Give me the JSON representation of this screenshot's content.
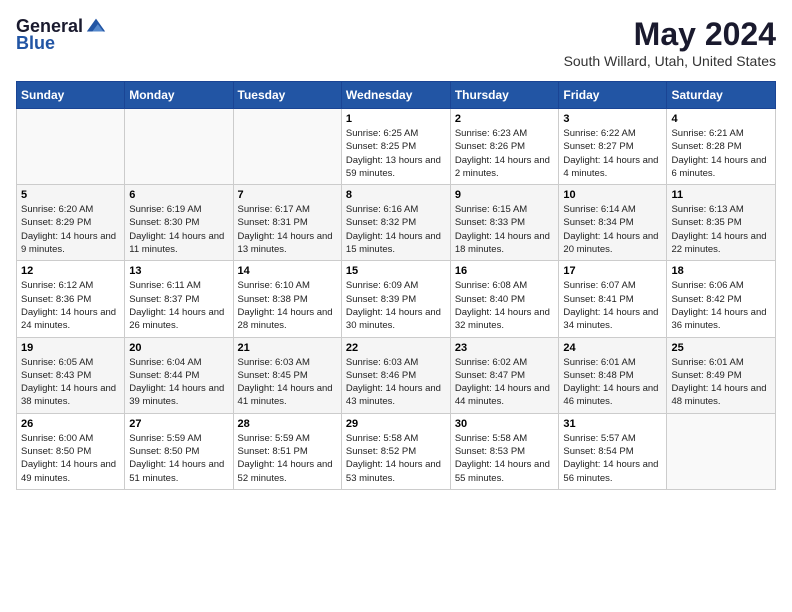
{
  "header": {
    "logo_general": "General",
    "logo_blue": "Blue",
    "month": "May 2024",
    "location": "South Willard, Utah, United States"
  },
  "weekdays": [
    "Sunday",
    "Monday",
    "Tuesday",
    "Wednesday",
    "Thursday",
    "Friday",
    "Saturday"
  ],
  "weeks": [
    [
      {
        "day": "",
        "info": ""
      },
      {
        "day": "",
        "info": ""
      },
      {
        "day": "",
        "info": ""
      },
      {
        "day": "1",
        "info": "Sunrise: 6:25 AM\nSunset: 8:25 PM\nDaylight: 13 hours and 59 minutes."
      },
      {
        "day": "2",
        "info": "Sunrise: 6:23 AM\nSunset: 8:26 PM\nDaylight: 14 hours and 2 minutes."
      },
      {
        "day": "3",
        "info": "Sunrise: 6:22 AM\nSunset: 8:27 PM\nDaylight: 14 hours and 4 minutes."
      },
      {
        "day": "4",
        "info": "Sunrise: 6:21 AM\nSunset: 8:28 PM\nDaylight: 14 hours and 6 minutes."
      }
    ],
    [
      {
        "day": "5",
        "info": "Sunrise: 6:20 AM\nSunset: 8:29 PM\nDaylight: 14 hours and 9 minutes."
      },
      {
        "day": "6",
        "info": "Sunrise: 6:19 AM\nSunset: 8:30 PM\nDaylight: 14 hours and 11 minutes."
      },
      {
        "day": "7",
        "info": "Sunrise: 6:17 AM\nSunset: 8:31 PM\nDaylight: 14 hours and 13 minutes."
      },
      {
        "day": "8",
        "info": "Sunrise: 6:16 AM\nSunset: 8:32 PM\nDaylight: 14 hours and 15 minutes."
      },
      {
        "day": "9",
        "info": "Sunrise: 6:15 AM\nSunset: 8:33 PM\nDaylight: 14 hours and 18 minutes."
      },
      {
        "day": "10",
        "info": "Sunrise: 6:14 AM\nSunset: 8:34 PM\nDaylight: 14 hours and 20 minutes."
      },
      {
        "day": "11",
        "info": "Sunrise: 6:13 AM\nSunset: 8:35 PM\nDaylight: 14 hours and 22 minutes."
      }
    ],
    [
      {
        "day": "12",
        "info": "Sunrise: 6:12 AM\nSunset: 8:36 PM\nDaylight: 14 hours and 24 minutes."
      },
      {
        "day": "13",
        "info": "Sunrise: 6:11 AM\nSunset: 8:37 PM\nDaylight: 14 hours and 26 minutes."
      },
      {
        "day": "14",
        "info": "Sunrise: 6:10 AM\nSunset: 8:38 PM\nDaylight: 14 hours and 28 minutes."
      },
      {
        "day": "15",
        "info": "Sunrise: 6:09 AM\nSunset: 8:39 PM\nDaylight: 14 hours and 30 minutes."
      },
      {
        "day": "16",
        "info": "Sunrise: 6:08 AM\nSunset: 8:40 PM\nDaylight: 14 hours and 32 minutes."
      },
      {
        "day": "17",
        "info": "Sunrise: 6:07 AM\nSunset: 8:41 PM\nDaylight: 14 hours and 34 minutes."
      },
      {
        "day": "18",
        "info": "Sunrise: 6:06 AM\nSunset: 8:42 PM\nDaylight: 14 hours and 36 minutes."
      }
    ],
    [
      {
        "day": "19",
        "info": "Sunrise: 6:05 AM\nSunset: 8:43 PM\nDaylight: 14 hours and 38 minutes."
      },
      {
        "day": "20",
        "info": "Sunrise: 6:04 AM\nSunset: 8:44 PM\nDaylight: 14 hours and 39 minutes."
      },
      {
        "day": "21",
        "info": "Sunrise: 6:03 AM\nSunset: 8:45 PM\nDaylight: 14 hours and 41 minutes."
      },
      {
        "day": "22",
        "info": "Sunrise: 6:03 AM\nSunset: 8:46 PM\nDaylight: 14 hours and 43 minutes."
      },
      {
        "day": "23",
        "info": "Sunrise: 6:02 AM\nSunset: 8:47 PM\nDaylight: 14 hours and 44 minutes."
      },
      {
        "day": "24",
        "info": "Sunrise: 6:01 AM\nSunset: 8:48 PM\nDaylight: 14 hours and 46 minutes."
      },
      {
        "day": "25",
        "info": "Sunrise: 6:01 AM\nSunset: 8:49 PM\nDaylight: 14 hours and 48 minutes."
      }
    ],
    [
      {
        "day": "26",
        "info": "Sunrise: 6:00 AM\nSunset: 8:50 PM\nDaylight: 14 hours and 49 minutes."
      },
      {
        "day": "27",
        "info": "Sunrise: 5:59 AM\nSunset: 8:50 PM\nDaylight: 14 hours and 51 minutes."
      },
      {
        "day": "28",
        "info": "Sunrise: 5:59 AM\nSunset: 8:51 PM\nDaylight: 14 hours and 52 minutes."
      },
      {
        "day": "29",
        "info": "Sunrise: 5:58 AM\nSunset: 8:52 PM\nDaylight: 14 hours and 53 minutes."
      },
      {
        "day": "30",
        "info": "Sunrise: 5:58 AM\nSunset: 8:53 PM\nDaylight: 14 hours and 55 minutes."
      },
      {
        "day": "31",
        "info": "Sunrise: 5:57 AM\nSunset: 8:54 PM\nDaylight: 14 hours and 56 minutes."
      },
      {
        "day": "",
        "info": ""
      }
    ]
  ]
}
